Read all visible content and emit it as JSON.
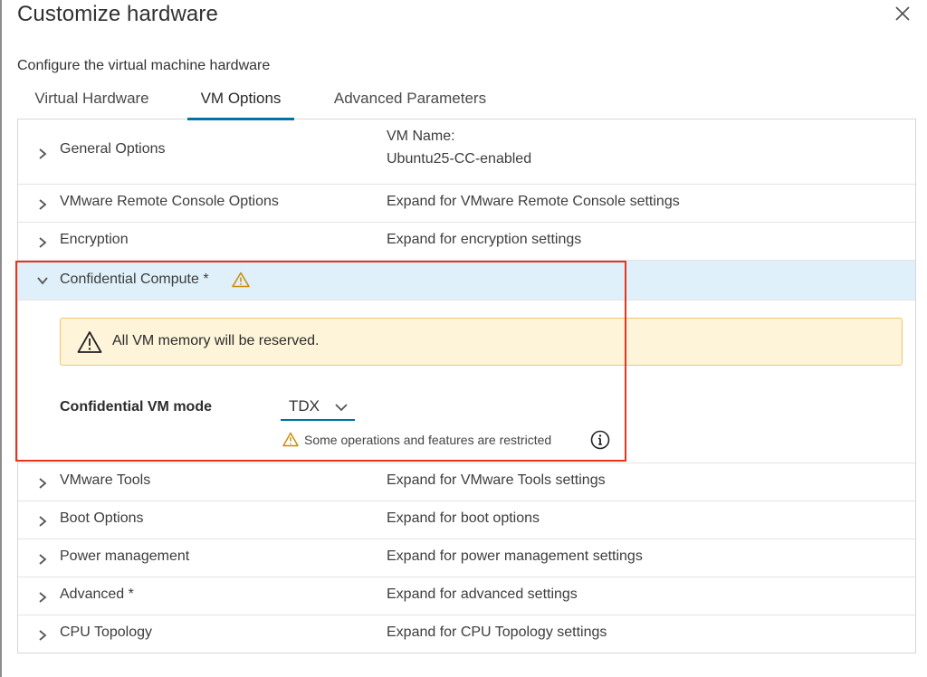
{
  "dialog": {
    "title": "Customize hardware",
    "subtitle": "Configure the virtual machine hardware"
  },
  "tabs": [
    {
      "label": "Virtual Hardware",
      "active": false
    },
    {
      "label": "VM Options",
      "active": true
    },
    {
      "label": "Advanced Parameters",
      "active": false
    }
  ],
  "rows": {
    "general": {
      "label": "General Options",
      "value_label": "VM Name:",
      "value": "Ubuntu25-CC-enabled"
    },
    "remote_console": {
      "label": "VMware Remote Console Options",
      "value": "Expand for VMware Remote Console settings"
    },
    "encryption": {
      "label": "Encryption",
      "value": "Expand for encryption settings"
    },
    "confidential": {
      "label": "Confidential Compute *",
      "alert_text": "All VM memory will be reserved.",
      "mode_label": "Confidential VM mode",
      "mode_value": "TDX",
      "restricted_text": "Some operations and features are restricted"
    },
    "tools": {
      "label": "VMware Tools",
      "value": "Expand for VMware Tools settings"
    },
    "boot": {
      "label": "Boot Options",
      "value": "Expand for boot options"
    },
    "power": {
      "label": "Power management",
      "value": "Expand for power management settings"
    },
    "advanced": {
      "label": "Advanced *",
      "value": "Expand for advanced settings"
    },
    "cpu": {
      "label": "CPU Topology",
      "value": "Expand for CPU Topology settings"
    }
  },
  "icons": {
    "close": "close-icon",
    "collapsed": "chevron-right-icon",
    "expanded": "chevron-down-icon",
    "warning": "warning-triangle-icon",
    "info": "info-circle-icon"
  },
  "colors": {
    "accent": "#0072a3",
    "expanded_row_bg": "#dff0fa",
    "alert_bg": "#fdf4d9",
    "alert_border": "#f3c56c",
    "warning_icon": "#c98a00",
    "highlight_box": "#e8341c"
  }
}
